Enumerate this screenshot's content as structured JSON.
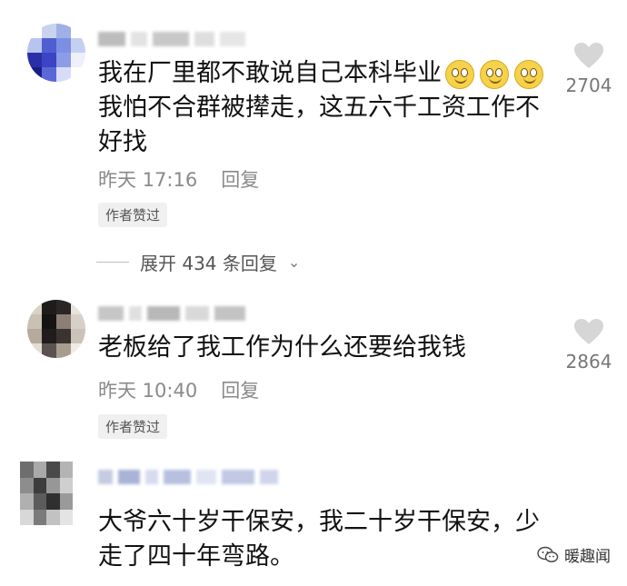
{
  "comments": [
    {
      "lines": [
        "我在厂里都不敢说自己本科毕业",
        "我怕不合群被撵走，这五六千工资工作不",
        "好找"
      ],
      "time": "昨天 17:16",
      "reply_label": "回复",
      "badge": "作者赞过",
      "likes": "2704",
      "emoji_count": 3
    },
    {
      "lines": [
        "老板给了我工作为什么还要给我钱"
      ],
      "time": "昨天 10:40",
      "reply_label": "回复",
      "badge": "作者赞过",
      "likes": "2864"
    },
    {
      "lines": [
        "大爷六十岁干保安，我二十岁干保安，少",
        "走了四十年弯路。"
      ]
    }
  ],
  "expand_replies": "展开 434 条回复",
  "watermark": "暖趣闻",
  "colors": {
    "text": "#111111",
    "meta": "#8a8a8a",
    "badge_bg": "#f0f0f0",
    "heart": "#d6d6d6"
  }
}
